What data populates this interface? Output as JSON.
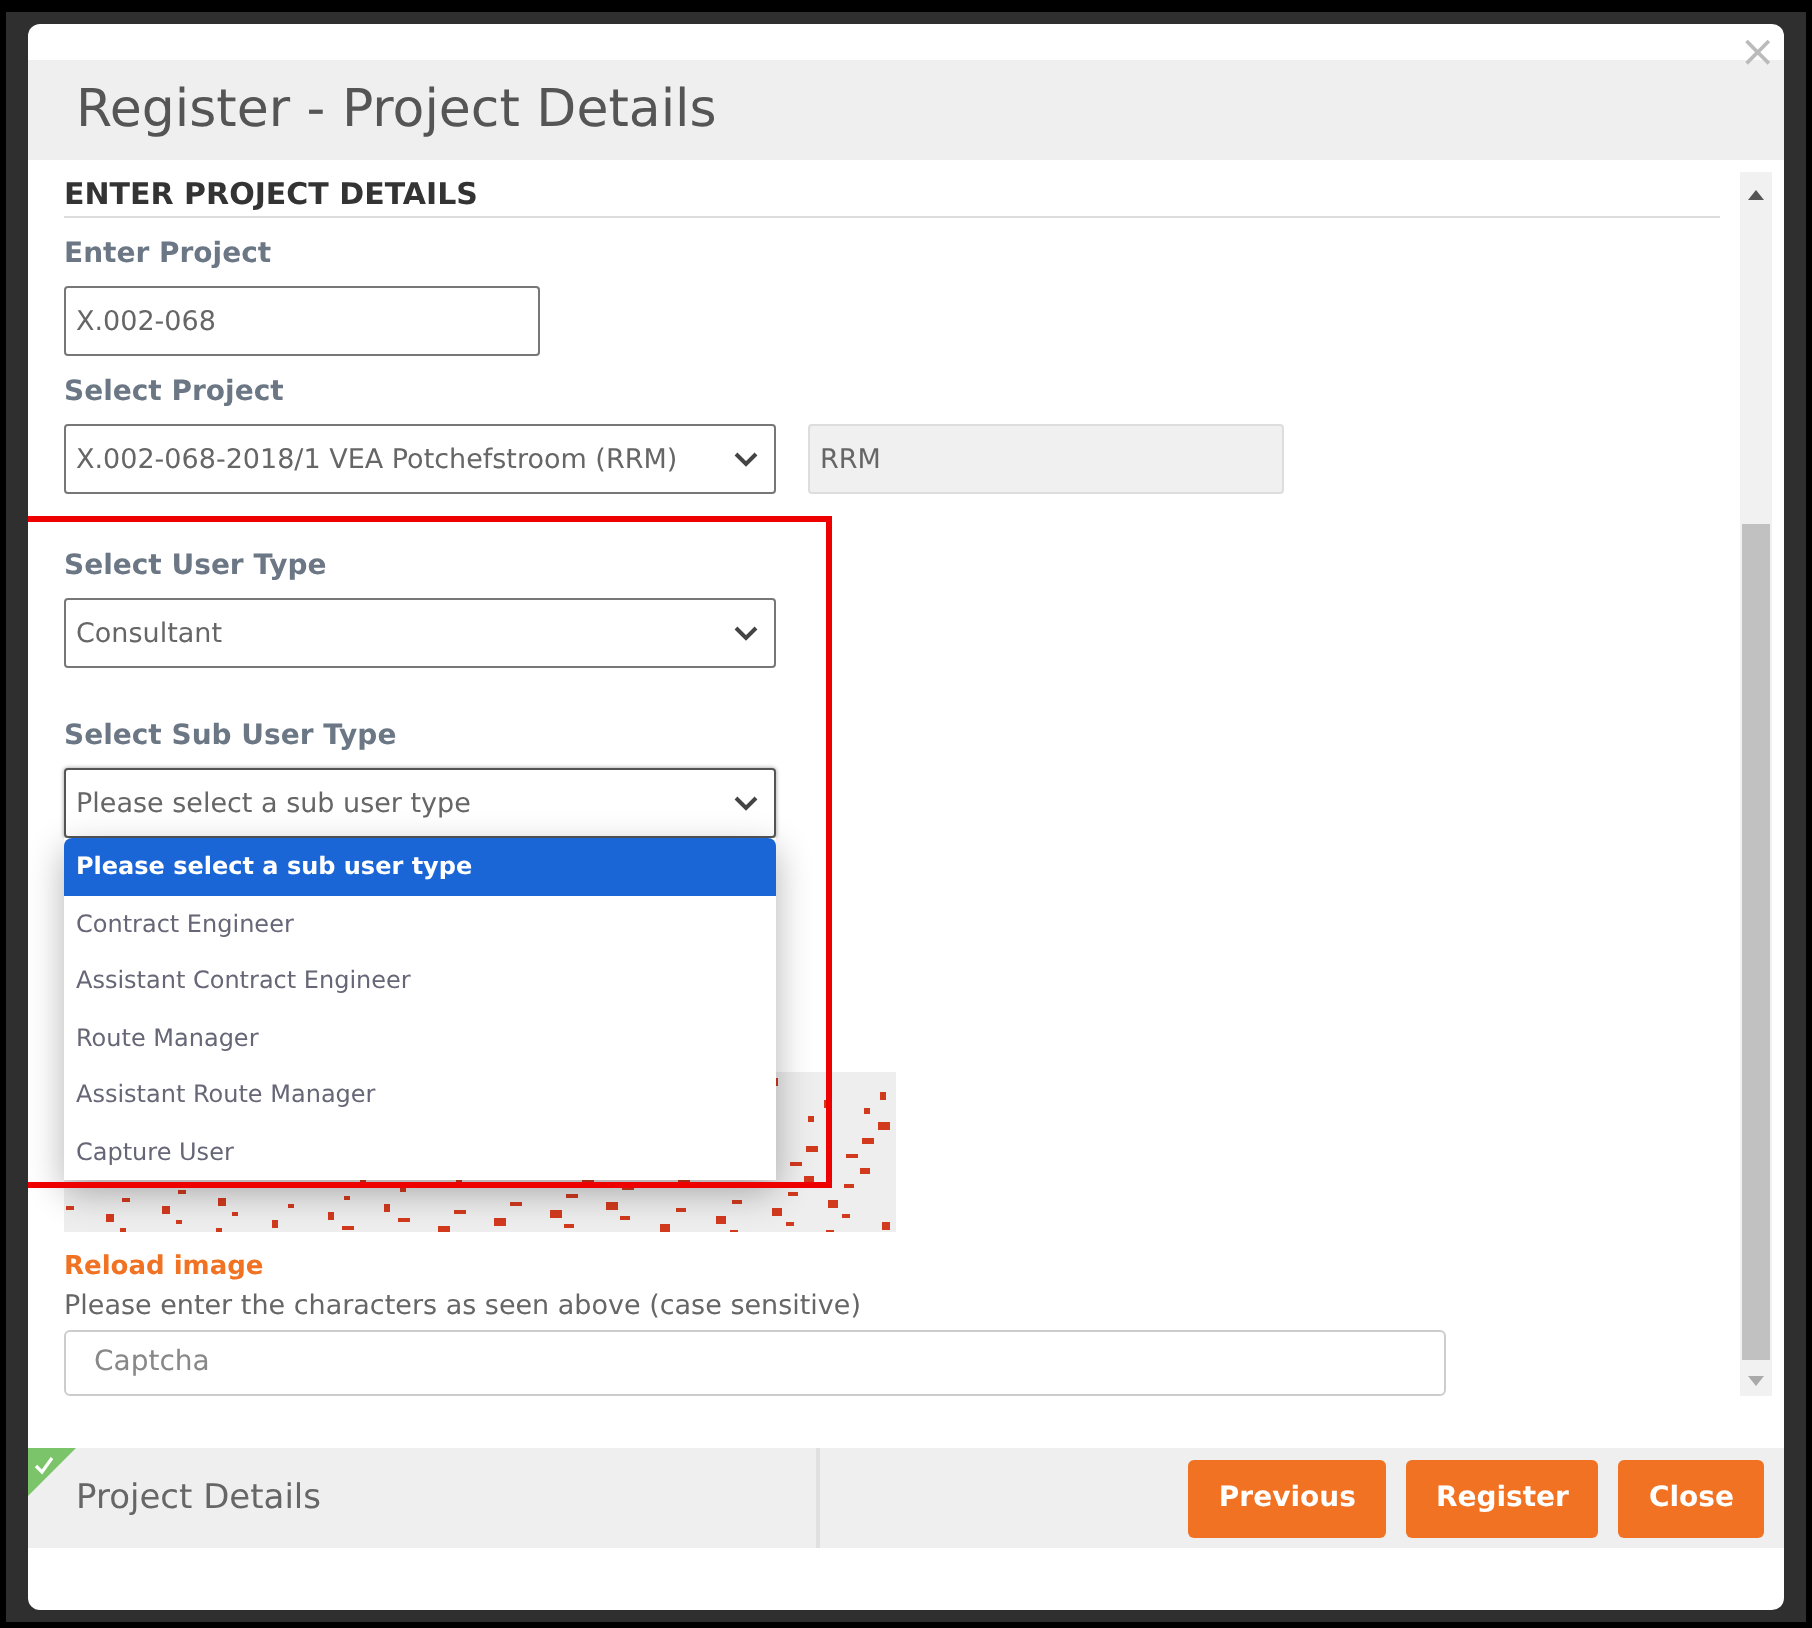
{
  "dialog": {
    "title": "Register - Project Details",
    "close_glyph": "×"
  },
  "section": {
    "heading": "ENTER PROJECT DETAILS"
  },
  "fields": [
    {
      "kind": "input",
      "label": "Enter Project",
      "value": "X.002-068"
    },
    {
      "kind": "select",
      "label": "Select Project",
      "value": "X.002-068-2018/1 VEA Potchefstroom (RRM)",
      "addon": "RRM"
    },
    {
      "kind": "select",
      "label": "Select User Type",
      "value": "Consultant"
    },
    {
      "kind": "select",
      "label": "Select Sub User Type",
      "value": "Please select a sub user type",
      "expanded": true,
      "options": [
        {
          "label": "Please select a sub user type",
          "selected": true
        },
        {
          "label": "Contract Engineer",
          "selected": false
        },
        {
          "label": "Assistant Contract Engineer",
          "selected": false
        },
        {
          "label": "Route Manager",
          "selected": false
        },
        {
          "label": "Assistant Route Manager",
          "selected": false
        },
        {
          "label": "Capture User",
          "selected": false
        }
      ]
    }
  ],
  "captcha": {
    "reload": "Reload image",
    "instruction": "Please enter the characters as seen above (case sensitive)",
    "placeholder": "Captcha"
  },
  "annotation": {
    "highlight_box": true
  },
  "footer": {
    "step": {
      "label": "Project Details",
      "done": true
    },
    "buttons": [
      "Previous",
      "Register",
      "Close"
    ]
  }
}
